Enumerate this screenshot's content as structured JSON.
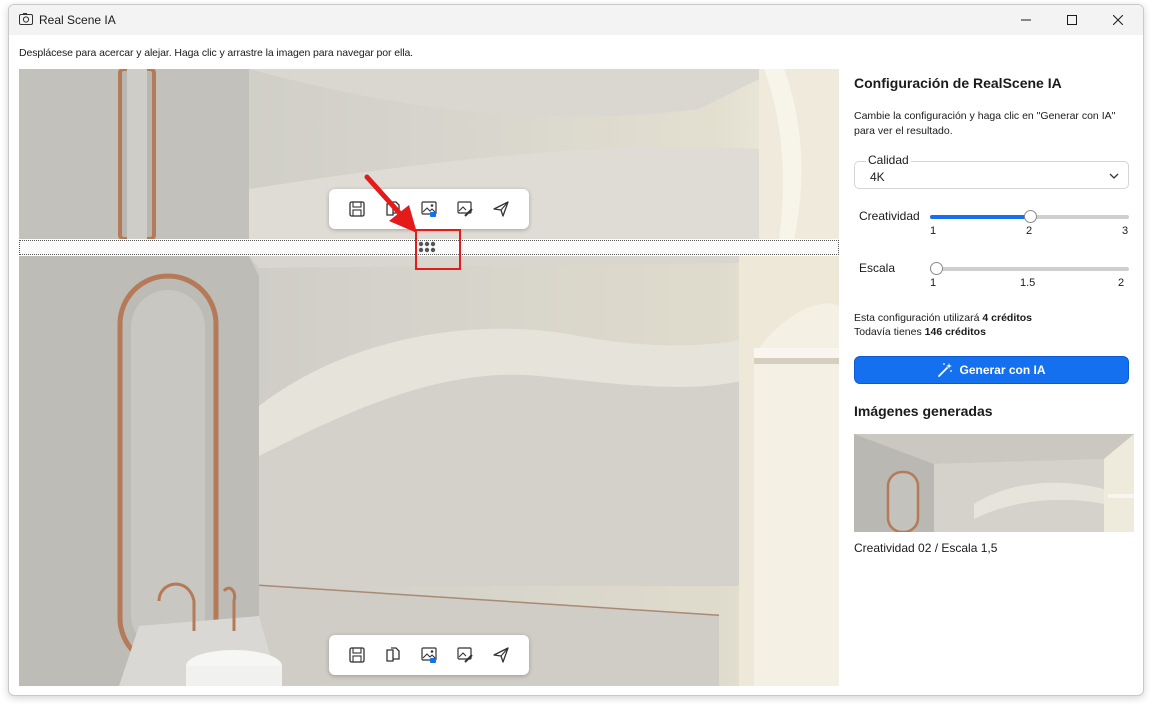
{
  "window": {
    "title": "Real Scene IA"
  },
  "viewer": {
    "hint": "Desplácese para acercar y alejar. Haga clic y arrastre la imagen para navegar por ella.",
    "toolbar_icons": [
      "save-icon",
      "copy-icon",
      "export-image-icon",
      "edit-image-icon",
      "send-icon"
    ]
  },
  "panel": {
    "title": "Configuración de RealScene IA",
    "description": "Cambie la configuración y haga clic en \"Generar con IA\" para ver el resultado.",
    "quality": {
      "label": "Calidad",
      "value": "4K"
    },
    "creatividad": {
      "label": "Creatividad",
      "min": 1,
      "max": 3,
      "value": 2,
      "ticks": [
        "1",
        "2",
        "3"
      ]
    },
    "escala": {
      "label": "Escala",
      "min": 1,
      "max": 2,
      "value": 1,
      "ticks": [
        "1",
        "1.5",
        "2"
      ]
    },
    "credits": {
      "line1_prefix": "Esta configuración utilizará ",
      "line1_value": "4 créditos",
      "line2_prefix": "Todavía tienes ",
      "line2_value": "146 créditos"
    },
    "generate_label": "Generar con IA",
    "generated_title": "Imágenes generadas",
    "generated_caption": "Creatividad 02 / Escala 1,5"
  },
  "colors": {
    "accent": "#1570ef",
    "highlight": "#e31b1b"
  }
}
